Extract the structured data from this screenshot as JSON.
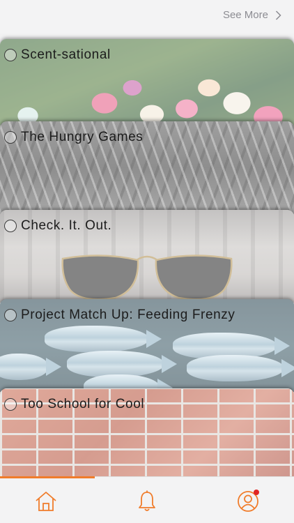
{
  "header": {
    "see_more_label": "See More"
  },
  "cards": [
    {
      "title": "Scent-sational",
      "image": "tulips"
    },
    {
      "title": "The Hungry Games",
      "image": "forks-and-spoons"
    },
    {
      "title": "Check. It. Out.",
      "image": "sunglasses-city"
    },
    {
      "title": "Project Match Up: Feeding Frenzy",
      "image": "fish"
    },
    {
      "title": "Too School for Cool",
      "image": "brick-wall"
    }
  ],
  "tabbar": {
    "tabs": [
      {
        "icon": "home-icon",
        "selected": true
      },
      {
        "icon": "bell-icon",
        "selected": false
      },
      {
        "icon": "profile-icon",
        "selected": false,
        "badge": true
      }
    ],
    "accent_color": "#f07c2b",
    "badge_color": "#e02424"
  }
}
